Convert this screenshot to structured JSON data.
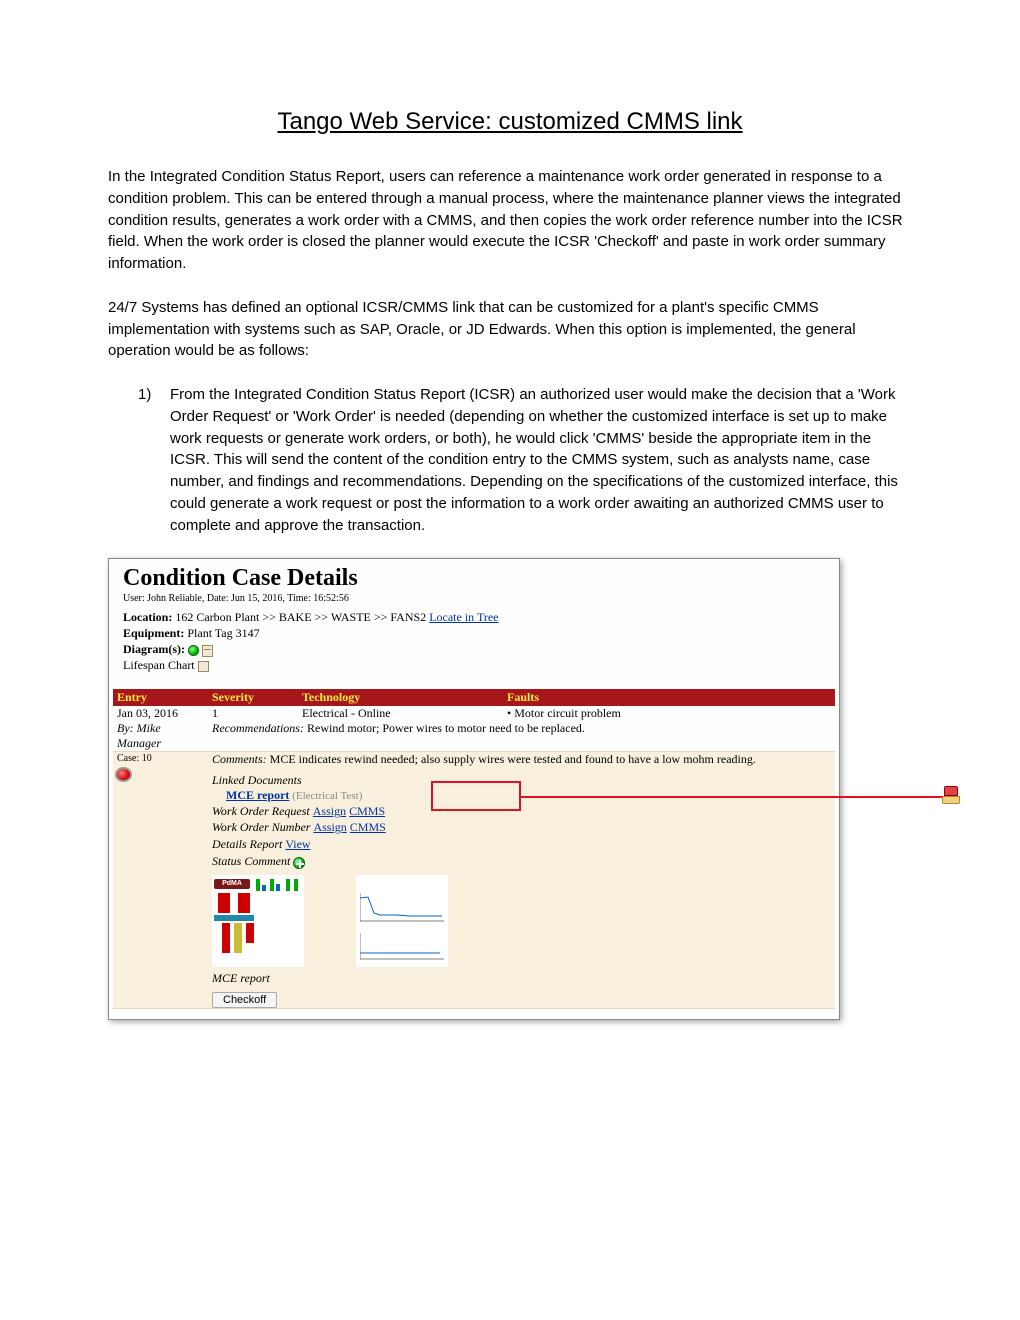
{
  "title": "Tango Web Service:  customized CMMS link",
  "para1": "In the Integrated Condition Status Report, users can reference a maintenance work order generated in response to a condition problem.  This can be entered through a manual process, where the maintenance planner views the integrated condition results, generates a work order with a CMMS, and then copies the work order reference number into the ICSR field. When the work order is closed the planner would execute the ICSR 'Checkoff' and paste in work order summary information.",
  "para2": "24/7 Systems has defined an optional ICSR/CMMS link that can be customized for a plant's specific CMMS implementation with systems such as SAP, Oracle, or JD Edwards.  When this option is implemented, the general operation would be as follows:",
  "list1_num": "1)",
  "list1": "From the Integrated Condition Status Report (ICSR) an authorized user would make the decision that a 'Work Order Request' or 'Work Order' is needed (depending on whether the customized interface is set up to make work requests or generate work orders, or both), he would click 'CMMS' beside the appropriate item in the ICSR. This will send the content of the condition entry to the CMMS system, such as analysts name, case number, and findings and recommendations. Depending on the specifications of the customized interface, this could generate a work request or post the information to a work order awaiting an authorized CMMS user to complete and approve the transaction.",
  "panel": {
    "title": "Condition Case Details",
    "meta": "User: John Reliable, Date: Jun 15, 2016, Time: 16:52:56",
    "location_lbl": "Location:",
    "location_val": " 162 Carbon Plant >> BAKE >> WASTE >> FANS2 ",
    "locate_link": "Locate in Tree",
    "equipment_lbl": "Equipment:",
    "equipment_val": " Plant Tag 3147",
    "diagram_lbl": "Diagram(s): ",
    "lifespan_lbl": "Lifespan Chart ",
    "columns": {
      "entry": "Entry",
      "severity": "Severity",
      "technology": "Technology",
      "faults": "Faults"
    },
    "row": {
      "entry_date": "Jan 03, 2016",
      "severity": "1",
      "technology": "Electrical - Online",
      "faults": "• Motor circuit problem",
      "by_lbl": "By:",
      "by_val": " Mike Manager",
      "case_lbl": "Case:",
      "case_val": " 10",
      "rec_lbl": "Recommendations:",
      "rec_val": " Rewind motor; Power wires to motor need to be replaced.",
      "com_lbl": "Comments:",
      "com_val": " MCE indicates rewind needed; also supply wires were tested and found to have a low mohm reading.",
      "linked_lbl": "Linked Documents",
      "mce_link": "MCE report",
      "mce_note": " (Electrical Test)",
      "wor_lbl": "Work Order Request ",
      "won_lbl": "Work Order Number ",
      "assign": "Assign",
      "cmms": "CMMS",
      "details_lbl": "Details Report ",
      "view": "View",
      "status_lbl": "Status Comment ",
      "thumb_lbl": "MCE report",
      "checkoff": "Checkoff"
    }
  }
}
